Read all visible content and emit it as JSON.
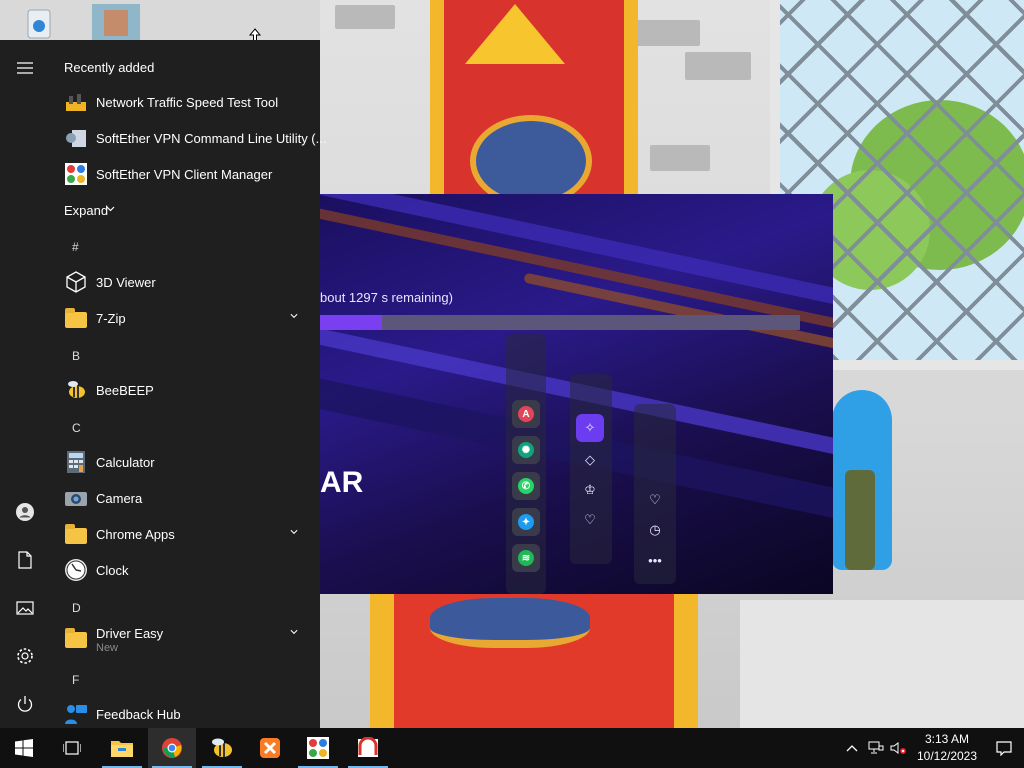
{
  "desktop": {
    "icons": [
      "recycle-bin-icon",
      "user-photo-icon"
    ]
  },
  "media_window": {
    "progress_text": "bout 1297 s remaining)",
    "progress_fraction": 0.13,
    "big_text": "AR",
    "dock_apps": [
      "a-app",
      "chatgpt",
      "whatsapp",
      "twitter",
      "spotify"
    ],
    "side_icons": [
      "sparkle-icon",
      "diamond-icon",
      "crown-icon",
      "heart-badge-icon",
      "heart-icon",
      "clock-icon",
      "more-icon"
    ],
    "accent": "#7b3ff2"
  },
  "start_menu": {
    "recently_added_label": "Recently added",
    "recent_apps": [
      {
        "label": "Network Traffic Speed Test Tool"
      },
      {
        "label": "SoftEther VPN Command Line Utility (..."
      },
      {
        "label": "SoftEther VPN Client Manager"
      }
    ],
    "expand_label": "Expand",
    "sections": [
      {
        "letter": "#",
        "apps": [
          {
            "label": "3D Viewer"
          },
          {
            "label": "7-Zip"
          }
        ]
      },
      {
        "letter": "B",
        "apps": [
          {
            "label": "BeeBEEP"
          }
        ]
      },
      {
        "letter": "C",
        "apps": [
          {
            "label": "Calculator"
          },
          {
            "label": "Camera"
          },
          {
            "label": "Chrome Apps"
          },
          {
            "label": "Clock"
          }
        ]
      },
      {
        "letter": "D",
        "apps": [
          {
            "label": "Driver Easy",
            "sub": "New"
          }
        ]
      },
      {
        "letter": "F",
        "apps": [
          {
            "label": "Feedback Hub"
          }
        ]
      }
    ]
  },
  "taskbar": {
    "pinned": [
      "start-button",
      "task-view",
      "file-explorer",
      "chrome",
      "beebeep",
      "xampp",
      "softether",
      "anydesk"
    ],
    "clock_time": "3:13 AM",
    "clock_date": "10/12/2023"
  }
}
